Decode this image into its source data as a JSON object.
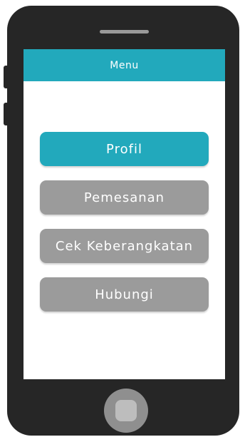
{
  "header": {
    "title": "Menu"
  },
  "menu": {
    "items": [
      {
        "label": "Profil"
      },
      {
        "label": "Pemesanan"
      },
      {
        "label": "Cek Keberangkatan"
      },
      {
        "label": "Hubungi"
      }
    ],
    "active_color": "#22a9bc",
    "inactive_color": "#9b9b9b"
  },
  "device": {
    "body_color": "#262626"
  }
}
